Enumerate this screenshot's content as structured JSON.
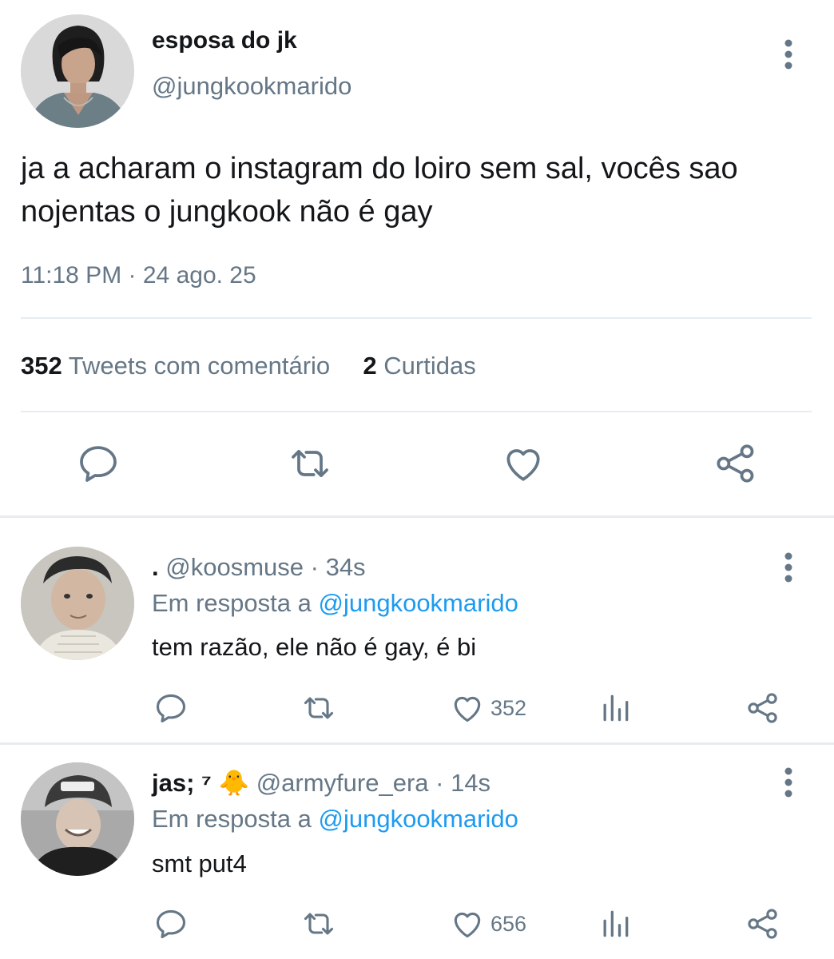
{
  "main_tweet": {
    "display_name": "esposa do jk",
    "handle": "@jungkookmarido",
    "text": "ja a acharam o instagram do loiro sem sal, vocês sao nojentas o jungkook não é gay",
    "time": "11:18 PM",
    "separator": "·",
    "date": "24 ago. 25",
    "quote_count": "352",
    "quote_label": "Tweets com comentário",
    "like_count": "2",
    "like_label": "Curtidas"
  },
  "replies": [
    {
      "display_name": ".",
      "handle": "@koosmuse",
      "time": "· 34s",
      "reply_prefix": "Em resposta a",
      "reply_to": "@jungkookmarido",
      "text": "tem razão, ele não é gay, é bi",
      "likes": "352"
    },
    {
      "display_name": "jas; ⁷",
      "emoji": "🐥",
      "handle": "@armyfure_era",
      "time": "· 14s",
      "reply_prefix": "Em resposta a",
      "reply_to": "@jungkookmarido",
      "text": "smt put4",
      "likes": "656"
    }
  ],
  "icons": {
    "reply": "comment-icon",
    "retweet": "retweet-icon",
    "like": "heart-icon",
    "share": "share-icon",
    "stats": "analytics-icon",
    "more": "more-vertical-icon"
  },
  "colors": {
    "text": "#14171a",
    "muted": "#657786",
    "link": "#1d9bf0",
    "divider": "#e6ecf0"
  }
}
